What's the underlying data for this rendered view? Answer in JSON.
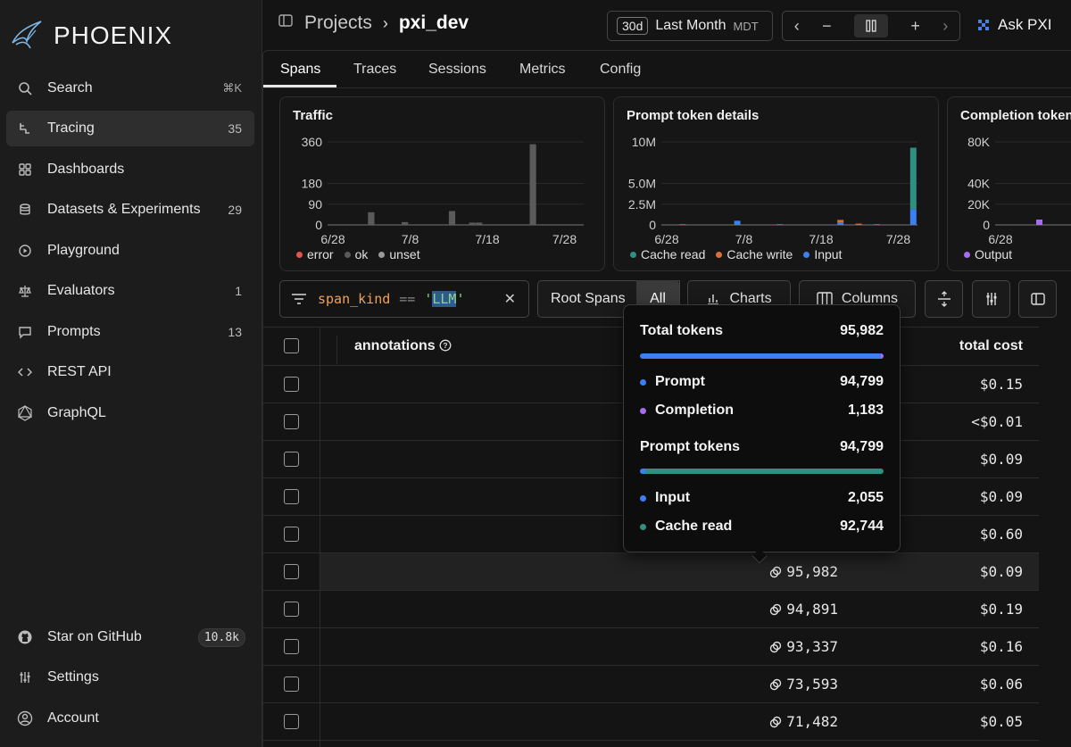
{
  "app": {
    "name": "PHOENIX"
  },
  "sidebar": {
    "items": [
      {
        "label": "Search",
        "shortcut": "⌘K"
      },
      {
        "label": "Tracing",
        "count": "35"
      },
      {
        "label": "Dashboards"
      },
      {
        "label": "Datasets & Experiments",
        "count": "29"
      },
      {
        "label": "Playground"
      },
      {
        "label": "Evaluators",
        "count": "1"
      },
      {
        "label": "Prompts",
        "count": "13"
      },
      {
        "label": "REST API"
      },
      {
        "label": "GraphQL"
      }
    ],
    "footer": [
      {
        "label": "Star on GitHub",
        "badge": "10.8k"
      },
      {
        "label": "Settings"
      },
      {
        "label": "Account"
      }
    ]
  },
  "header": {
    "breadcrumb_root": "Projects",
    "breadcrumb_sep": "›",
    "project": "pxi_dev",
    "time_range": {
      "days": "30d",
      "label": "Last Month",
      "tz": "MDT"
    },
    "nav": {
      "prev": "‹",
      "minus": "−",
      "plus": "+",
      "next": "›"
    },
    "ask_label": "Ask PXI"
  },
  "tabs": [
    "Spans",
    "Traces",
    "Sessions",
    "Metrics",
    "Config"
  ],
  "chart_data": [
    {
      "type": "bar",
      "title": "Traffic",
      "yticks": [
        "360",
        "180",
        "90",
        "0"
      ],
      "ylim": [
        0,
        360
      ],
      "xticks": [
        "6/28",
        "7/8",
        "7/18",
        "7/28"
      ],
      "series": [
        {
          "name": "error",
          "color": "#e5534b"
        },
        {
          "name": "ok",
          "color": "#5a5a5a"
        },
        {
          "name": "unset",
          "color": "#9a9a9a"
        }
      ],
      "bars": [
        0,
        0,
        0,
        0,
        0,
        0,
        55,
        0,
        0,
        0,
        0,
        12,
        0,
        0,
        0,
        0,
        0,
        0,
        60,
        0,
        0,
        10,
        10,
        0,
        0,
        0,
        0,
        0,
        0,
        0,
        350,
        0,
        0,
        0,
        0,
        0,
        0,
        0
      ]
    },
    {
      "type": "bar",
      "title": "Prompt token details",
      "yticks": [
        "10M",
        "5.0M",
        "2.5M",
        "0"
      ],
      "ylim": [
        0,
        10000000
      ],
      "xticks": [
        "6/28",
        "7/8",
        "7/18",
        "7/28"
      ],
      "series": [
        {
          "name": "Cache read",
          "color": "#2f8f80"
        },
        {
          "name": "Cache write",
          "color": "#d9703a"
        },
        {
          "name": "Input",
          "color": "#3b7ff2"
        }
      ]
    },
    {
      "type": "bar",
      "title": "Completion tokens",
      "yticks": [
        "80K",
        "40K",
        "20K",
        "0"
      ],
      "ylim": [
        0,
        80000
      ],
      "xticks": [
        "6/28"
      ],
      "series": [
        {
          "name": "Output",
          "color": "#a56cf0"
        }
      ]
    }
  ],
  "filter": {
    "key": "span_kind",
    "op": "==",
    "quote": "'",
    "value": "LLM"
  },
  "toolbar": {
    "root_spans": "Root Spans",
    "all": "All",
    "charts": "Charts",
    "columns": "Columns"
  },
  "table": {
    "headers": {
      "annotations": "annotations",
      "total_cost": "total cost"
    },
    "rows": [
      {
        "tokens": "",
        "cost": "$0.15"
      },
      {
        "tokens": "",
        "cost": "<$0.01"
      },
      {
        "tokens": "",
        "cost": "$0.09"
      },
      {
        "tokens": "",
        "cost": "$0.09"
      },
      {
        "tokens": "",
        "cost": "$0.60"
      },
      {
        "tokens": "95,982",
        "cost": "$0.09"
      },
      {
        "tokens": "94,891",
        "cost": "$0.19"
      },
      {
        "tokens": "93,337",
        "cost": "$0.16"
      },
      {
        "tokens": "73,593",
        "cost": "$0.06"
      },
      {
        "tokens": "71,482",
        "cost": "$0.05"
      }
    ]
  },
  "tooltip": {
    "total_label": "Total tokens",
    "total": "95,982",
    "prompt_label": "Prompt",
    "prompt": "94,799",
    "completion_label": "Completion",
    "completion": "1,183",
    "prompt_tokens_label": "Prompt tokens",
    "prompt_tokens": "94,799",
    "input_label": "Input",
    "input": "2,055",
    "cache_read_label": "Cache read",
    "cache_read": "92,744",
    "colors": {
      "prompt": "#3b7ff2",
      "completion": "#a56cf0",
      "input": "#3b7ff2",
      "cache_read": "#2f8f80"
    }
  }
}
